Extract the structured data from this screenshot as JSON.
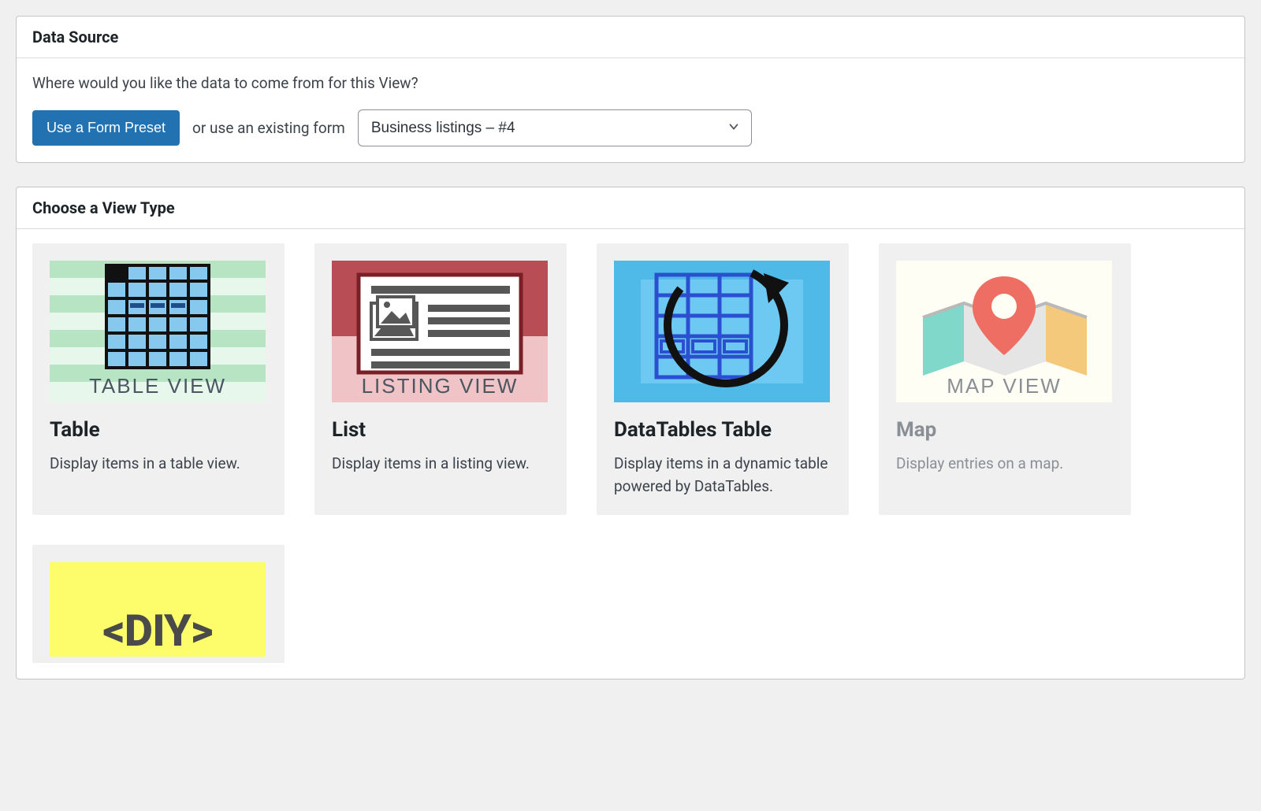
{
  "data_source": {
    "title": "Data Source",
    "prompt": "Where would you like the data to come from for this View?",
    "preset_button": "Use a Form Preset",
    "or_label": "or use an existing form",
    "selected_form": "Business listings – #4"
  },
  "view_type": {
    "title": "Choose a View Type",
    "cards": [
      {
        "title": "Table",
        "desc": "Display items in a table view.",
        "thumb_label": "TABLE VIEW"
      },
      {
        "title": "List",
        "desc": "Display items in a listing view.",
        "thumb_label": "LISTING VIEW"
      },
      {
        "title": "DataTables Table",
        "desc": "Display items in a dynamic table powered by DataTables.",
        "thumb_label": ""
      },
      {
        "title": "Map",
        "desc": "Display entries on a map.",
        "thumb_label": "MAP VIEW"
      },
      {
        "title": "",
        "desc": "",
        "thumb_label": "<DIY>"
      }
    ]
  }
}
